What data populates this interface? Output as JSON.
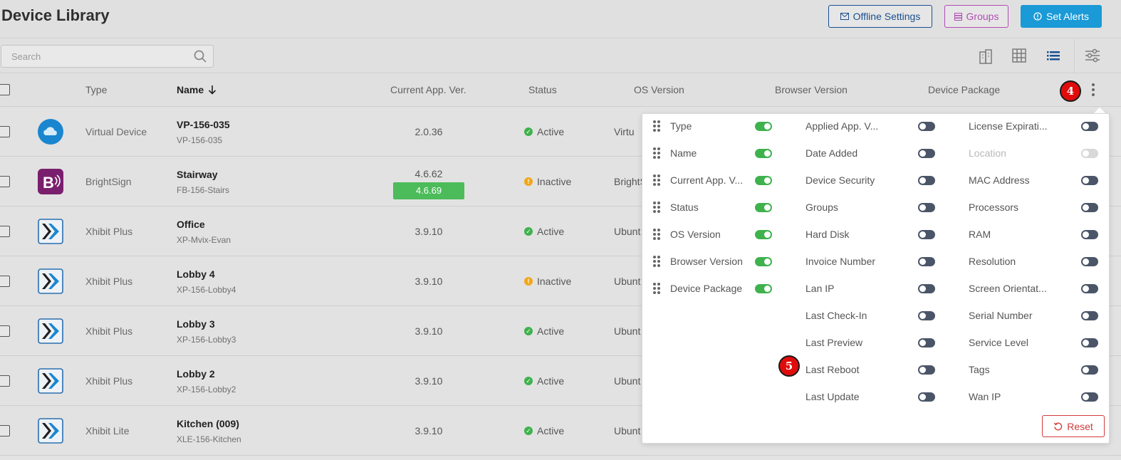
{
  "header": {
    "title": "Device Library",
    "offline_settings": "Offline Settings",
    "groups": "Groups",
    "set_alerts": "Set Alerts"
  },
  "toolbar": {
    "search_placeholder": "Search"
  },
  "table": {
    "columns": {
      "type": "Type",
      "name": "Name",
      "current_app_ver": "Current App. Ver.",
      "status": "Status",
      "os_version": "OS Version",
      "browser_version": "Browser Version",
      "device_package": "Device Package"
    },
    "rows": [
      {
        "type": "Virtual Device",
        "name": "VP-156-035",
        "sub": "VP-156-035",
        "ver": "2.0.36",
        "status": "Active",
        "os": "Virtu",
        "icon": "cloud-icon"
      },
      {
        "type": "BrightSign",
        "name": "Stairway",
        "sub": "FB-156-Stairs",
        "ver": "4.6.62",
        "ver_update": "4.6.69",
        "status": "Inactive",
        "os": "BrightS",
        "icon": "brightsign-icon"
      },
      {
        "type": "Xhibit Plus",
        "name": "Office",
        "sub": "XP-Mvix-Evan",
        "ver": "3.9.10",
        "status": "Active",
        "os": "Ubunt",
        "icon": "xhibit-icon"
      },
      {
        "type": "Xhibit Plus",
        "name": "Lobby 4",
        "sub": "XP-156-Lobby4",
        "ver": "3.9.10",
        "status": "Inactive",
        "os": "Ubunt",
        "icon": "xhibit-icon"
      },
      {
        "type": "Xhibit Plus",
        "name": "Lobby 3",
        "sub": "XP-156-Lobby3",
        "ver": "3.9.10",
        "status": "Active",
        "os": "Ubunt",
        "icon": "xhibit-icon"
      },
      {
        "type": "Xhibit Plus",
        "name": "Lobby 2",
        "sub": "XP-156-Lobby2",
        "ver": "3.9.10",
        "status": "Active",
        "os": "Ubunt",
        "icon": "xhibit-icon"
      },
      {
        "type": "Xhibit Lite",
        "name": "Kitchen (009)",
        "sub": "XLE-156-Kitchen",
        "ver": "3.9.10",
        "status": "Active",
        "os": "Ubunt",
        "icon": "xhibit-icon"
      }
    ]
  },
  "steps": {
    "four": "4",
    "five": "5"
  },
  "column_menu": {
    "col1": [
      {
        "label": "Type",
        "state": "on"
      },
      {
        "label": "Name",
        "state": "on"
      },
      {
        "label": "Current App. V...",
        "state": "on"
      },
      {
        "label": "Status",
        "state": "on"
      },
      {
        "label": "OS Version",
        "state": "on"
      },
      {
        "label": "Browser Version",
        "state": "on"
      },
      {
        "label": "Device Package",
        "state": "on"
      }
    ],
    "col2": [
      {
        "label": "Applied App. V...",
        "state": "off"
      },
      {
        "label": "Date Added",
        "state": "off"
      },
      {
        "label": "Device Security",
        "state": "off"
      },
      {
        "label": "Groups",
        "state": "off"
      },
      {
        "label": "Hard Disk",
        "state": "off"
      },
      {
        "label": "Invoice Number",
        "state": "off"
      },
      {
        "label": "Lan IP",
        "state": "off"
      },
      {
        "label": "Last Check-In",
        "state": "off"
      },
      {
        "label": "Last Preview",
        "state": "off"
      },
      {
        "label": "Last Reboot",
        "state": "off"
      },
      {
        "label": "Last Update",
        "state": "off"
      }
    ],
    "col3": [
      {
        "label": "License Expirati...",
        "state": "off"
      },
      {
        "label": "Location",
        "state": "disabled"
      },
      {
        "label": "MAC Address",
        "state": "off"
      },
      {
        "label": "Processors",
        "state": "off"
      },
      {
        "label": "RAM",
        "state": "off"
      },
      {
        "label": "Resolution",
        "state": "off"
      },
      {
        "label": "Screen Orientat...",
        "state": "off"
      },
      {
        "label": "Serial Number",
        "state": "off"
      },
      {
        "label": "Service Level",
        "state": "off"
      },
      {
        "label": "Tags",
        "state": "off"
      },
      {
        "label": "Wan IP",
        "state": "off"
      }
    ],
    "reset": "Reset"
  },
  "colors": {
    "active": "#3fb24d",
    "inactive": "#f2a718",
    "accent_blue": "#1a9ad6",
    "groups_purple": "#b14db5",
    "reset_red": "#d23b3b"
  }
}
